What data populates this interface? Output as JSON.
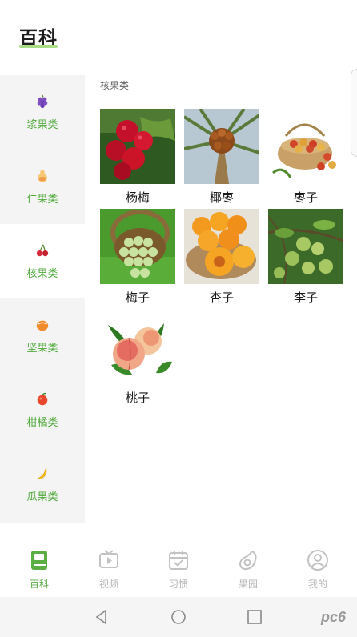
{
  "header": {
    "title": "百科"
  },
  "sidebar": {
    "items": [
      {
        "label": "浆果类",
        "icon": "grape-icon",
        "active": false
      },
      {
        "label": "仁果类",
        "icon": "pear-icon",
        "active": false
      },
      {
        "label": "核果类",
        "icon": "cherry-icon",
        "active": true
      },
      {
        "label": "坚果类",
        "icon": "nut-icon",
        "active": false
      },
      {
        "label": "柑橘类",
        "icon": "orange-icon",
        "active": false
      },
      {
        "label": "瓜果类",
        "icon": "banana-icon",
        "active": false
      }
    ]
  },
  "content": {
    "section_title": "核果类",
    "fruits": [
      {
        "name": "杨梅",
        "image": "bayberry-photo"
      },
      {
        "name": "椰枣",
        "image": "date-palm-photo"
      },
      {
        "name": "枣子",
        "image": "jujube-photo"
      },
      {
        "name": "梅子",
        "image": "green-plum-photo"
      },
      {
        "name": "杏子",
        "image": "apricot-photo"
      },
      {
        "name": "李子",
        "image": "plum-photo"
      },
      {
        "name": "桃子",
        "image": "peach-photo"
      }
    ]
  },
  "tabbar": {
    "tabs": [
      {
        "label": "百科",
        "icon": "book-icon",
        "active": true
      },
      {
        "label": "视频",
        "icon": "video-icon",
        "active": false
      },
      {
        "label": "习惯",
        "icon": "calendar-check-icon",
        "active": false
      },
      {
        "label": "果园",
        "icon": "avocado-icon",
        "active": false
      },
      {
        "label": "我的",
        "icon": "user-icon",
        "active": false
      }
    ]
  },
  "system_nav": {
    "watermark": "pc6"
  },
  "colors": {
    "accent": "#5aae43",
    "sidebar_bg": "#f4f4f4",
    "inactive": "#b5b5b5"
  }
}
